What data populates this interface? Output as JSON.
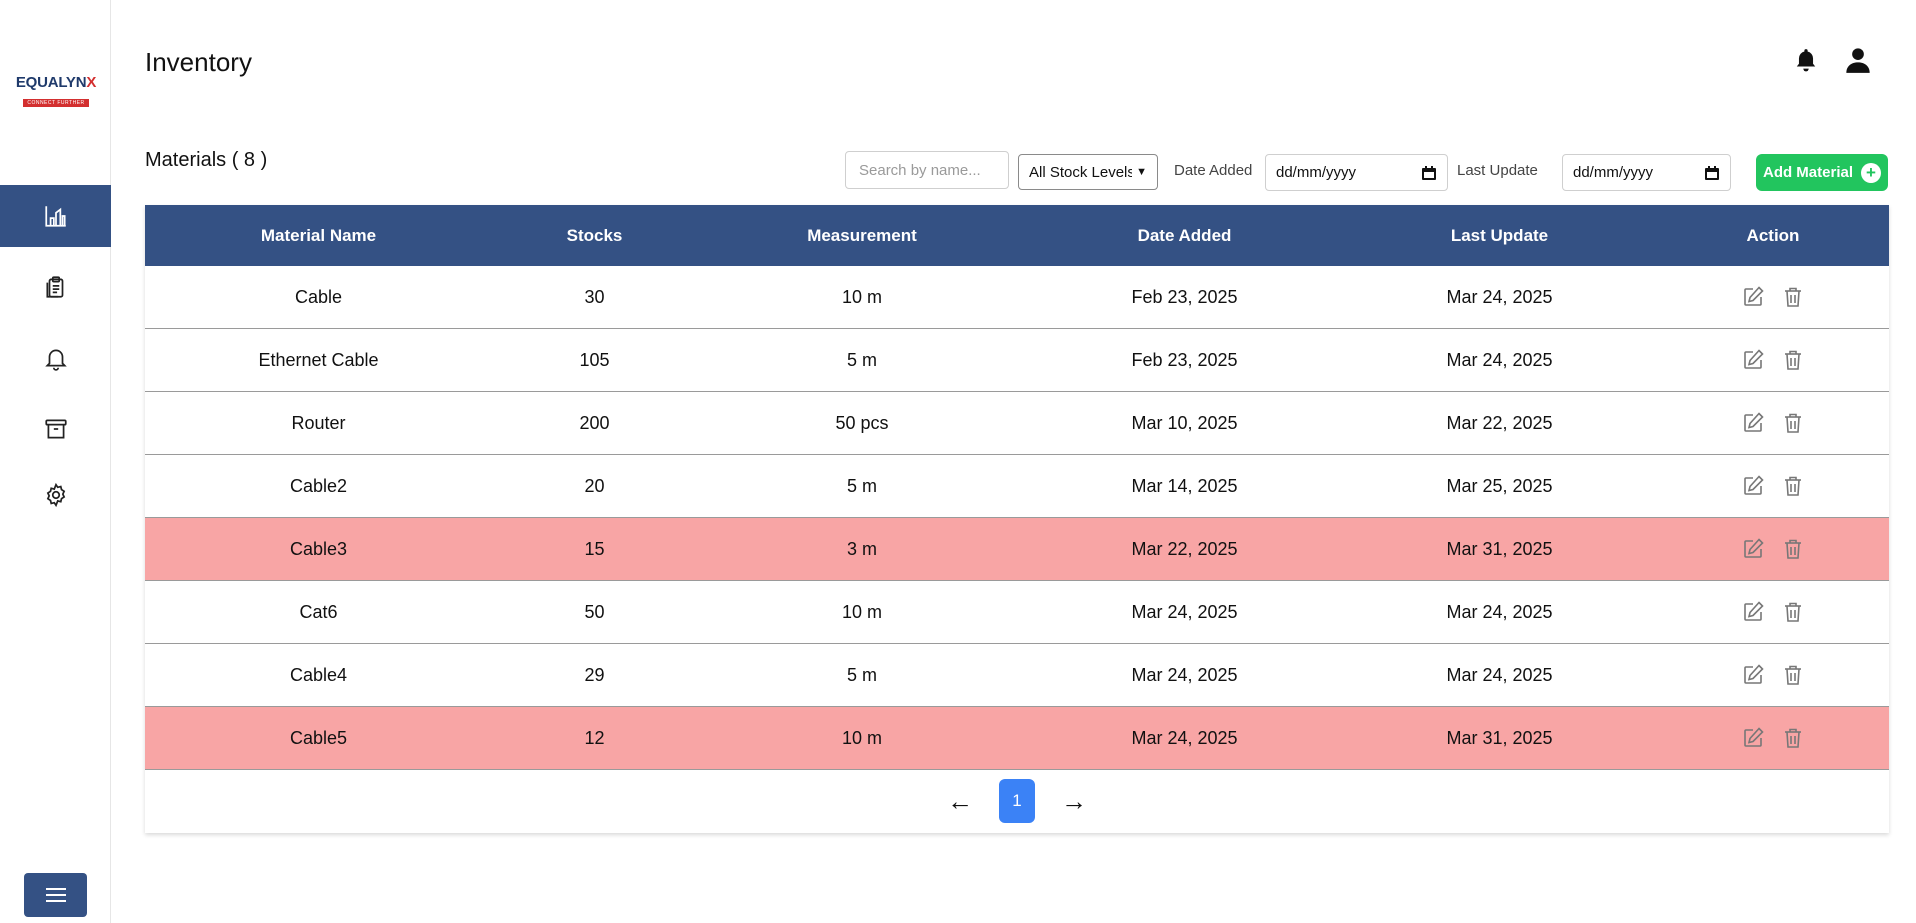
{
  "brand": {
    "name_main": "EQUALYN",
    "name_x": "X",
    "tagline": "CONNECT FURTHER"
  },
  "header": {
    "title": "Inventory"
  },
  "toolbar": {
    "heading": "Materials ( 8 )",
    "search_placeholder": "Search by name...",
    "stock_filter_value": "All Stock Levels",
    "date_added_label": "Date Added",
    "date_added_placeholder": "dd/mm/yyyy",
    "last_update_label": "Last Update",
    "last_update_placeholder": "dd/mm/yyyy",
    "add_label": "Add Material"
  },
  "table": {
    "headers": {
      "name": "Material Name",
      "stocks": "Stocks",
      "measurement": "Measurement",
      "date_added": "Date Added",
      "last_update": "Last Update",
      "action": "Action"
    },
    "rows": [
      {
        "name": "Cable",
        "stocks": "30",
        "measurement": "10 m",
        "date_added": "Feb 23, 2025",
        "last_update": "Mar 24, 2025",
        "low": false
      },
      {
        "name": "Ethernet Cable",
        "stocks": "105",
        "measurement": "5 m",
        "date_added": "Feb 23, 2025",
        "last_update": "Mar 24, 2025",
        "low": false
      },
      {
        "name": "Router",
        "stocks": "200",
        "measurement": "50 pcs",
        "date_added": "Mar 10, 2025",
        "last_update": "Mar 22, 2025",
        "low": false
      },
      {
        "name": "Cable2",
        "stocks": "20",
        "measurement": "5 m",
        "date_added": "Mar 14, 2025",
        "last_update": "Mar 25, 2025",
        "low": false
      },
      {
        "name": "Cable3",
        "stocks": "15",
        "measurement": "3 m",
        "date_added": "Mar 22, 2025",
        "last_update": "Mar 31, 2025",
        "low": true
      },
      {
        "name": "Cat6",
        "stocks": "50",
        "measurement": "10 m",
        "date_added": "Mar 24, 2025",
        "last_update": "Mar 24, 2025",
        "low": false
      },
      {
        "name": "Cable4",
        "stocks": "29",
        "measurement": "5 m",
        "date_added": "Mar 24, 2025",
        "last_update": "Mar 24, 2025",
        "low": false
      },
      {
        "name": "Cable5",
        "stocks": "12",
        "measurement": "10 m",
        "date_added": "Mar 24, 2025",
        "last_update": "Mar 31, 2025",
        "low": true
      }
    ]
  },
  "pagination": {
    "prev": "←",
    "current": "1",
    "next": "→"
  },
  "colors": {
    "primary": "#345184",
    "low_stock_row": "#f8a5a5",
    "add_button": "#22c55e",
    "page_active": "#3b82f6"
  }
}
